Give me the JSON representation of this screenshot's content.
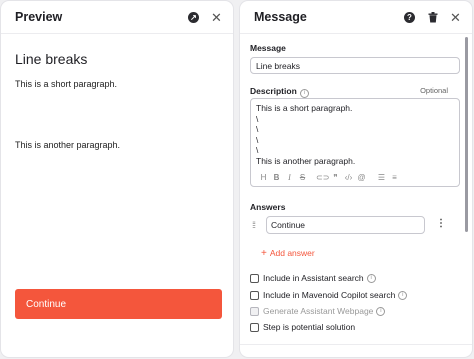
{
  "preview": {
    "title": "Preview",
    "content_title": "Line breaks",
    "paragraph_1": "This is a short paragraph.",
    "paragraph_2": "This is another paragraph.",
    "continue_label": "Continue"
  },
  "message": {
    "title": "Message",
    "message_label": "Message",
    "message_value": "Line breaks",
    "description_label": "Description",
    "optional_label": "Optional",
    "description_value": "This is a short paragraph.\n\\\n\\\n\\\n\\\nThis is another paragraph.",
    "toolbar_icons": [
      "heading-icon",
      "bold-icon",
      "italic-icon",
      "strikethrough-icon",
      "link-icon",
      "quote-icon",
      "code-icon",
      "attachment-icon",
      "bullet-list-icon",
      "numbered-list-icon"
    ],
    "answers_label": "Answers",
    "answer_value": "Continue",
    "add_answer_label": "Add answer",
    "checkboxes": [
      {
        "label": "Include in Assistant search",
        "checked": false,
        "disabled": false
      },
      {
        "label": "Include in Mavenoid Copilot search",
        "checked": false,
        "disabled": false
      },
      {
        "label": "Generate Assistant Webpage",
        "checked": false,
        "disabled": true
      },
      {
        "label": "Step is potential solution",
        "checked": false,
        "disabled": false
      }
    ]
  },
  "colors": {
    "accent": "#f4563c",
    "background": "#f0f0f2"
  }
}
